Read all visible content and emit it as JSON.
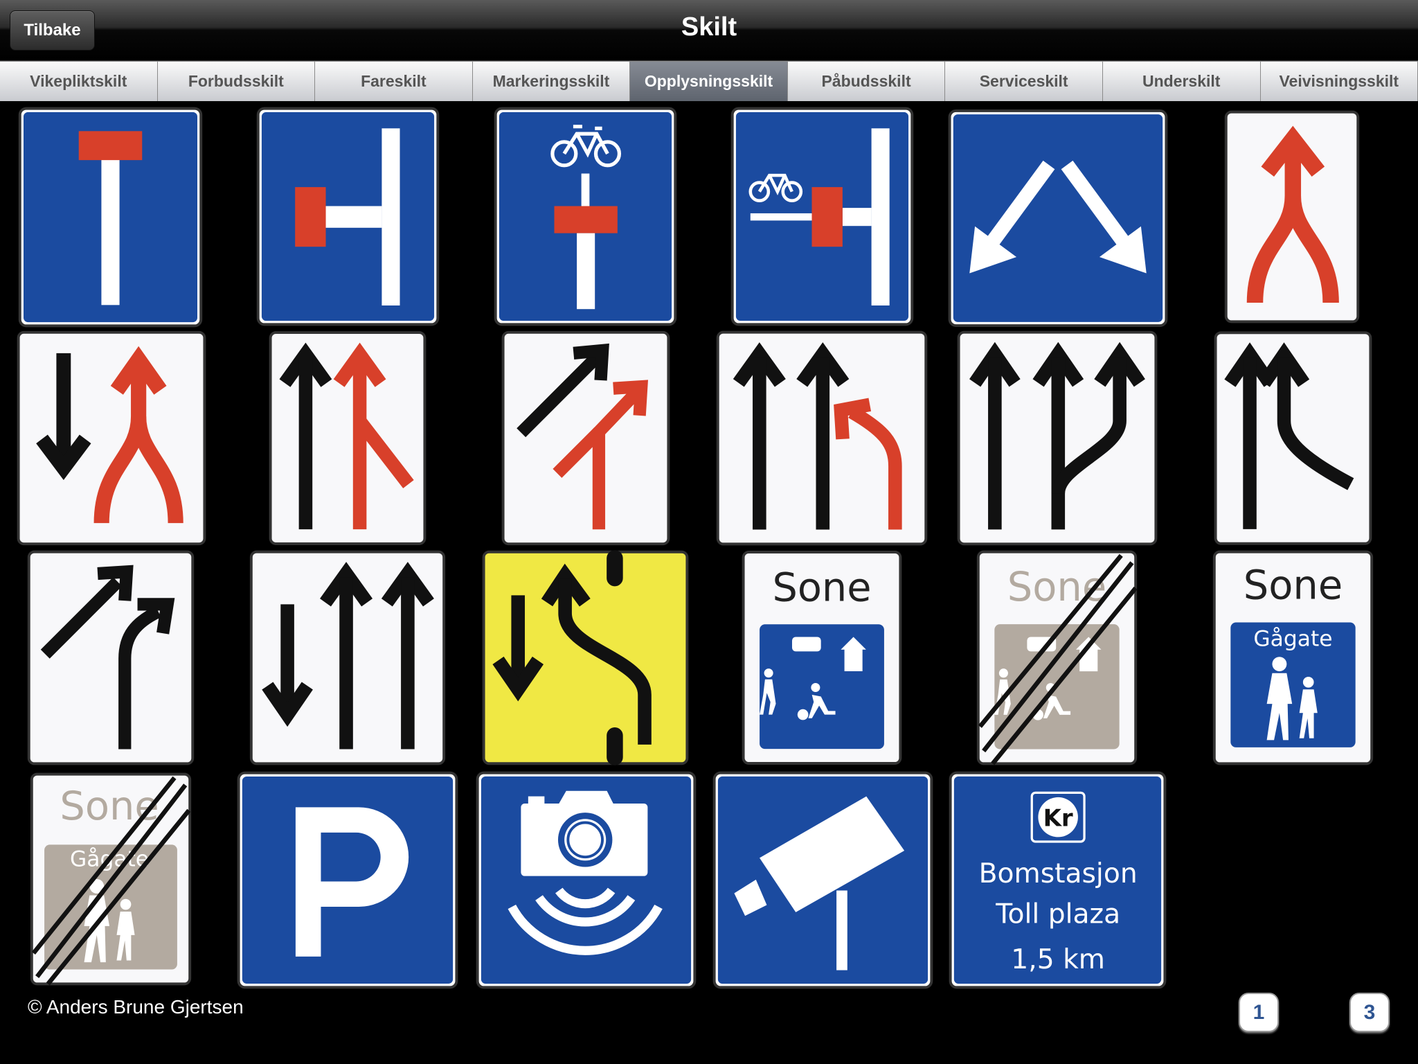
{
  "header": {
    "title": "Skilt",
    "back_label": "Tilbake"
  },
  "tabs": [
    {
      "label": "Vikepliktskilt"
    },
    {
      "label": "Forbudsskilt"
    },
    {
      "label": "Fareskilt"
    },
    {
      "label": "Markeringsskilt"
    },
    {
      "label": "Opplysningsskilt",
      "active": true
    },
    {
      "label": "Påbudsskilt"
    },
    {
      "label": "Serviceskilt"
    },
    {
      "label": "Underskilt"
    },
    {
      "label": "Veivisningsskilt"
    }
  ],
  "sign_text": {
    "sone": "Sone",
    "gagate": "Gågate",
    "kr": "Kr",
    "toll_line1": "Bomstasjon",
    "toll_line2": "Toll plaza",
    "toll_distance": "1,5 km"
  },
  "colors": {
    "sign_blue": "#1b4ba0",
    "sign_red": "#d8402a",
    "sign_yellow": "#f0e844",
    "end_grey": "#b3aaa0"
  },
  "footer": {
    "copyright": "© Anders Brune Gjertsen"
  },
  "pagination": {
    "prev": "1",
    "next": "3"
  }
}
